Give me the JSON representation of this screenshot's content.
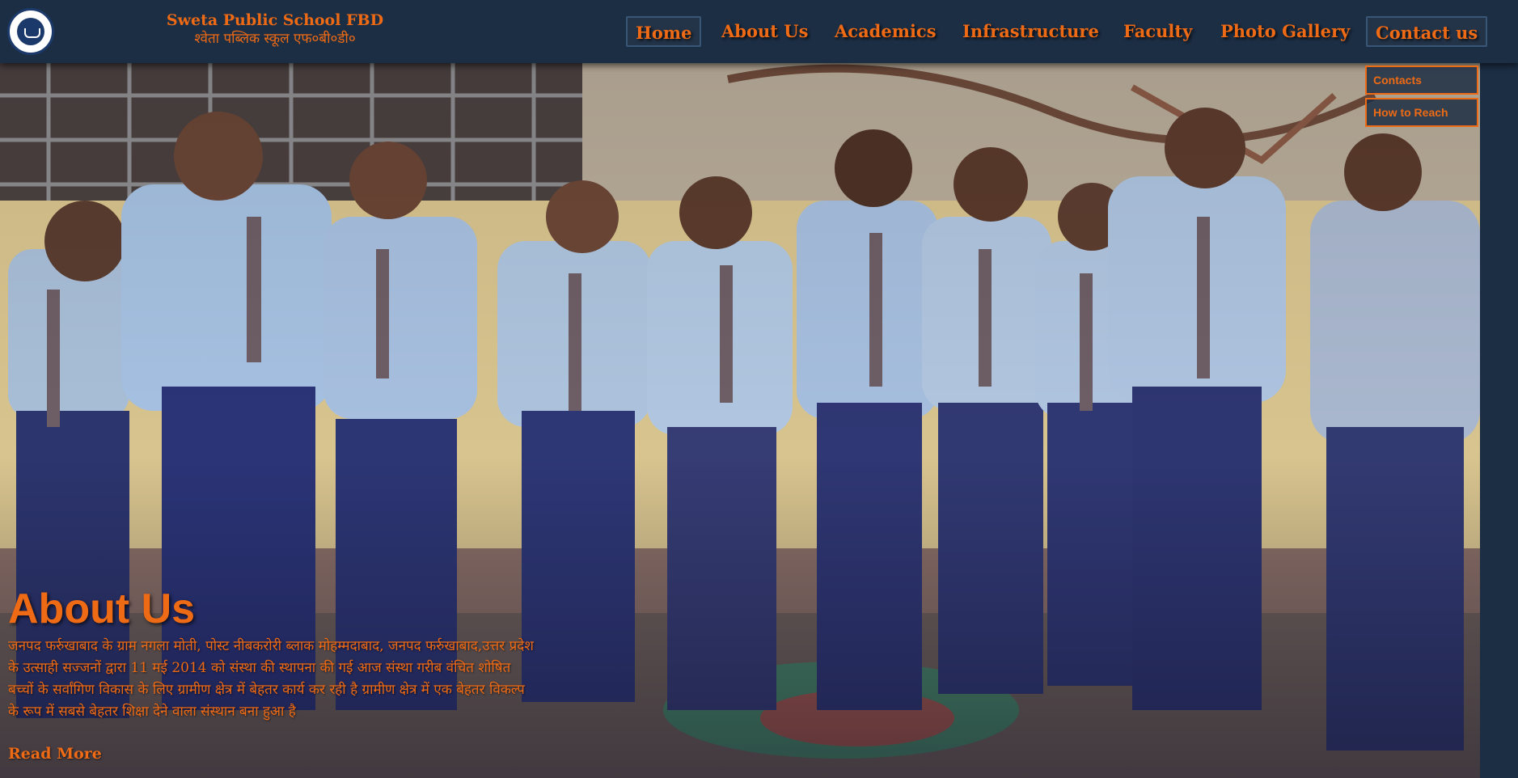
{
  "header": {
    "school_name": "Sweta Public School FBD",
    "school_name_hindi": "श्वेता पब्लिक स्कूल एफ०बी०डी०"
  },
  "nav": {
    "home": "Home",
    "about": "About Us",
    "academics": "Academics",
    "infrastructure": "Infrastructure",
    "faculty": "Faculty",
    "gallery": "Photo Gallery",
    "contact": "Contact us"
  },
  "dropdown": {
    "contacts": "Contacts",
    "how_to_reach": "How to Reach"
  },
  "about": {
    "title": "About Us",
    "text": "जनपद फर्रुखाबाद के ग्राम नगला मोती, पोस्ट नीबकरोरी ब्लाक मोहम्मदाबाद, जनपद फर्रुखाबाद,उत्तर प्रदेश के उत्साही सज्जनों द्वारा 11 मई 2014 को संस्था की स्थापना की गई आज संस्था गरीब वंचित शोषित बच्चों के सर्वांगिण विकास के लिए ग्रामीण क्षेत्र में बेहतर कार्य कर रही है ग्रामीण क्षेत्र में एक बेहतर विकल्प के रूप में सबसे बेहतर शिक्षा देने वाला संस्थान बना हुआ है",
    "read_more": "Read More"
  },
  "colors": {
    "header_bg": "#1c2e44",
    "accent": "#ef6a14"
  },
  "icons": {
    "logo": "school-logo-icon"
  }
}
